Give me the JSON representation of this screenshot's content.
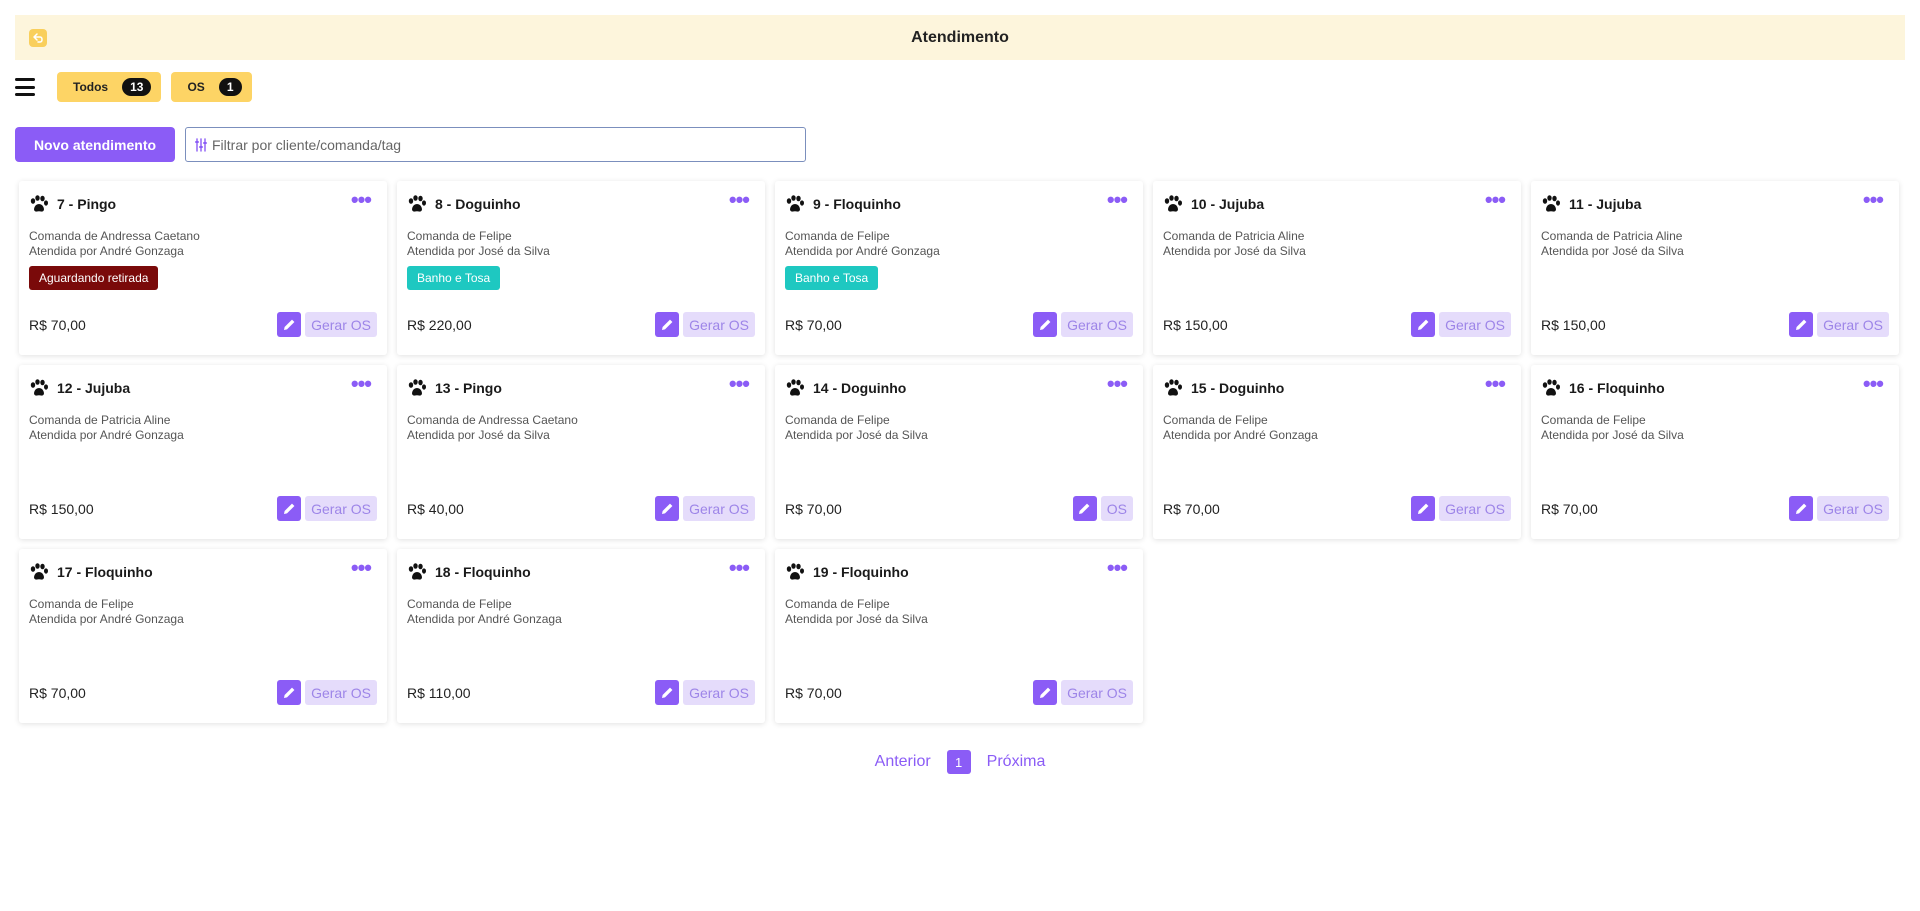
{
  "header": {
    "title": "Atendimento"
  },
  "filters": [
    {
      "label": "Todos",
      "count": "13"
    },
    {
      "label": "OS",
      "count": "1"
    }
  ],
  "actions": {
    "new_label": "Novo atendimento",
    "search_placeholder": "Filtrar por cliente/comanda/tag"
  },
  "cards": [
    {
      "title": "7 - Pingo",
      "comanda": "Comanda de Andressa Caetano",
      "atendida": "Atendida por André Gonzaga",
      "tag": "Aguardando retirada",
      "tag_color": "#7a0a0a",
      "price": "R$ 70,00",
      "os_label": "Gerar OS"
    },
    {
      "title": "8 - Doguinho",
      "comanda": "Comanda de Felipe",
      "atendida": "Atendida por José da Silva",
      "tag": "Banho e Tosa",
      "tag_color": "#1ec8c1",
      "price": "R$ 220,00",
      "os_label": "Gerar OS"
    },
    {
      "title": "9 - Floquinho",
      "comanda": "Comanda de Felipe",
      "atendida": "Atendida por André Gonzaga",
      "tag": "Banho e Tosa",
      "tag_color": "#1ec8c1",
      "price": "R$ 70,00",
      "os_label": "Gerar OS"
    },
    {
      "title": "10 - Jujuba",
      "comanda": "Comanda de Patricia Aline",
      "atendida": "Atendida por José da Silva",
      "tag": "",
      "tag_color": "",
      "price": "R$ 150,00",
      "os_label": "Gerar OS"
    },
    {
      "title": "11 - Jujuba",
      "comanda": "Comanda de Patricia Aline",
      "atendida": "Atendida por José da Silva",
      "tag": "",
      "tag_color": "",
      "price": "R$ 150,00",
      "os_label": "Gerar OS"
    },
    {
      "title": "12 - Jujuba",
      "comanda": "Comanda de Patricia Aline",
      "atendida": "Atendida por André Gonzaga",
      "tag": "",
      "tag_color": "",
      "price": "R$ 150,00",
      "os_label": "Gerar OS"
    },
    {
      "title": "13 - Pingo",
      "comanda": "Comanda de Andressa Caetano",
      "atendida": "Atendida por José da Silva",
      "tag": "",
      "tag_color": "",
      "price": "R$ 40,00",
      "os_label": "Gerar OS"
    },
    {
      "title": "14 - Doguinho",
      "comanda": "Comanda de Felipe",
      "atendida": "Atendida por José da Silva",
      "tag": "",
      "tag_color": "",
      "price": "R$ 70,00",
      "os_label": "OS"
    },
    {
      "title": "15 - Doguinho",
      "comanda": "Comanda de Felipe",
      "atendida": "Atendida por André Gonzaga",
      "tag": "",
      "tag_color": "",
      "price": "R$ 70,00",
      "os_label": "Gerar OS"
    },
    {
      "title": "16 - Floquinho",
      "comanda": "Comanda de Felipe",
      "atendida": "Atendida por José da Silva",
      "tag": "",
      "tag_color": "",
      "price": "R$ 70,00",
      "os_label": "Gerar OS"
    },
    {
      "title": "17 - Floquinho",
      "comanda": "Comanda de Felipe",
      "atendida": "Atendida por André Gonzaga",
      "tag": "",
      "tag_color": "",
      "price": "R$ 70,00",
      "os_label": "Gerar OS"
    },
    {
      "title": "18 - Floquinho",
      "comanda": "Comanda de Felipe",
      "atendida": "Atendida por André Gonzaga",
      "tag": "",
      "tag_color": "",
      "price": "R$ 110,00",
      "os_label": "Gerar OS"
    },
    {
      "title": "19 - Floquinho",
      "comanda": "Comanda de Felipe",
      "atendida": "Atendida por José da Silva",
      "tag": "",
      "tag_color": "",
      "price": "R$ 70,00",
      "os_label": "Gerar OS"
    }
  ],
  "pagination": {
    "prev": "Anterior",
    "current": "1",
    "next": "Próxima"
  },
  "icons": {
    "back": "back-arrow-icon",
    "menu": "hamburger-menu-icon",
    "filter": "sliders-icon",
    "pet": "paw-icon",
    "more": "more-dots-icon",
    "edit": "pencil-icon"
  },
  "colors": {
    "accent": "#8b5cf6",
    "header_bg": "#fdf5dc",
    "tab_bg": "#fdd465"
  }
}
